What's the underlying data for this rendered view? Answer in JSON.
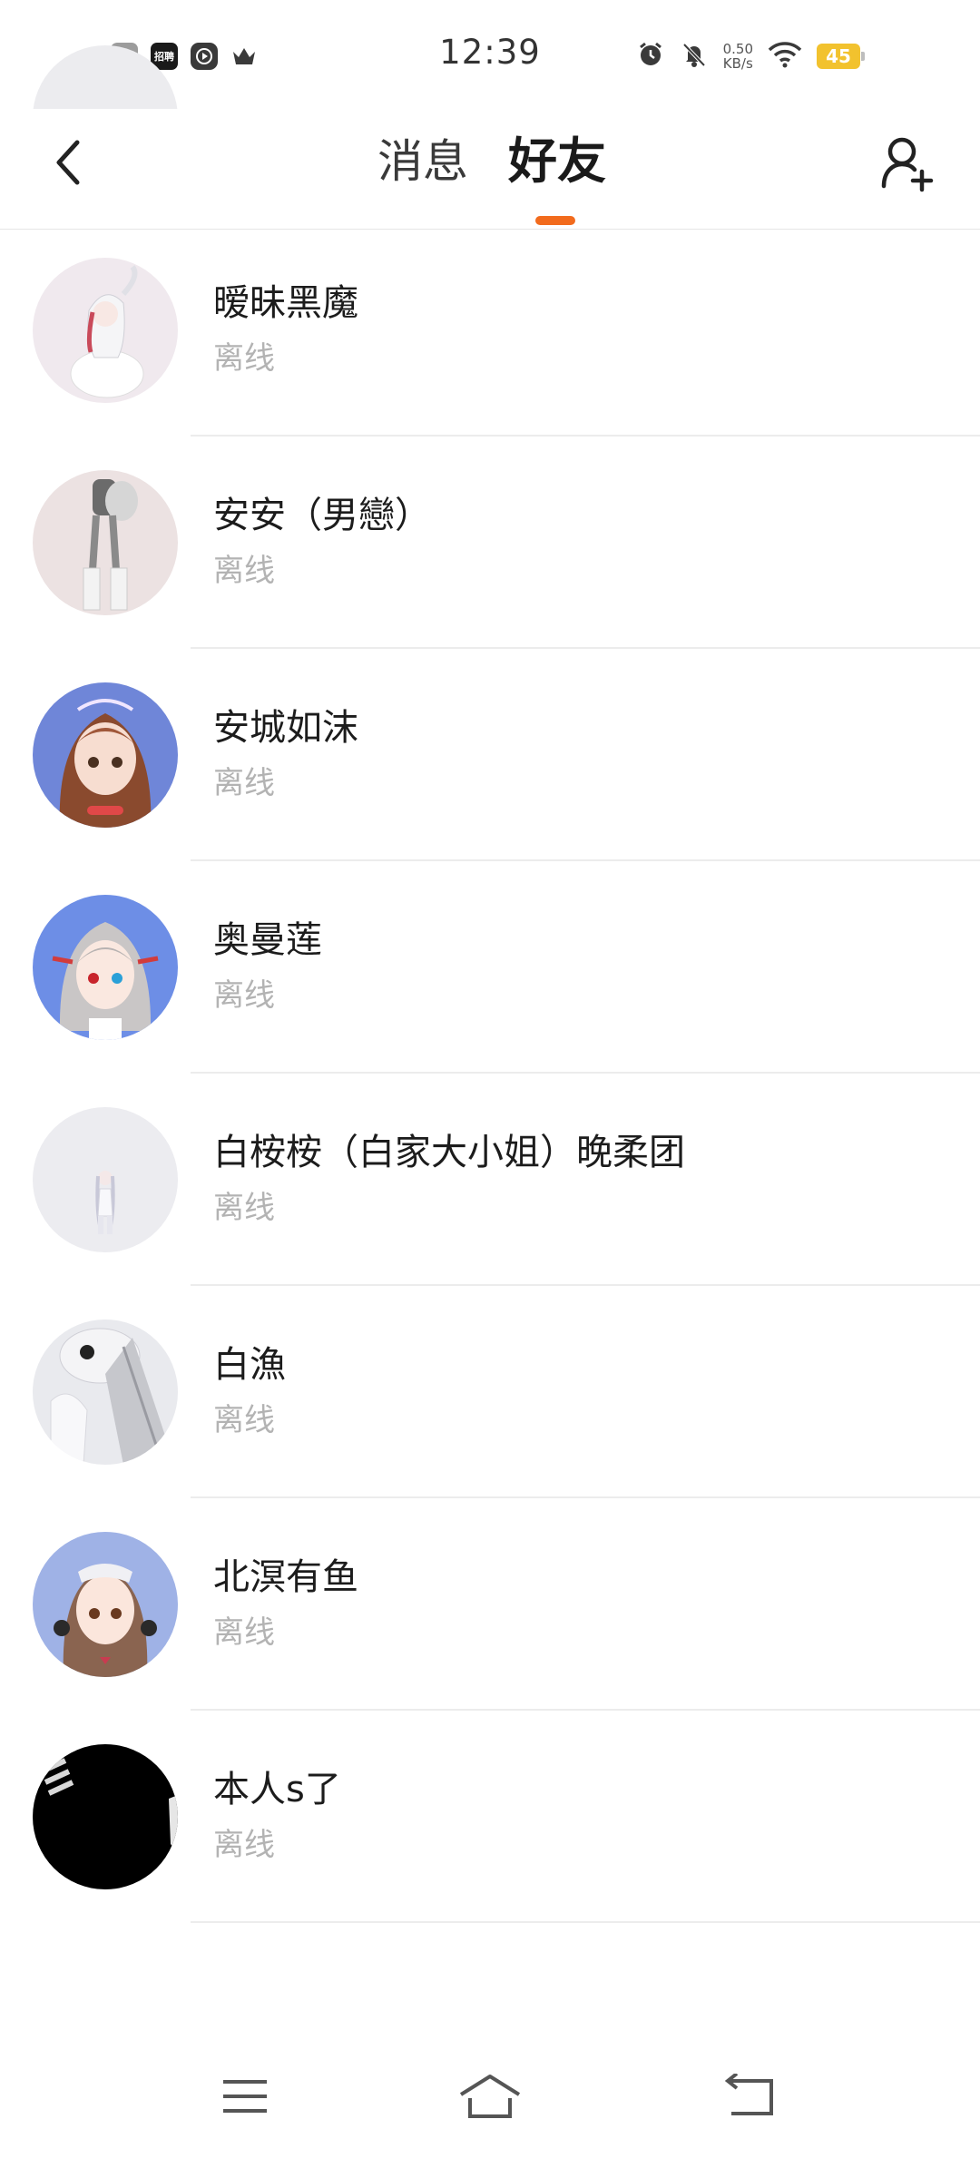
{
  "status_bar": {
    "time": "12:39",
    "net_speed_value": "0.50",
    "net_speed_unit": "KB/s",
    "battery_level": "45",
    "app_icon_label": "招聘"
  },
  "header": {
    "tab_messages": "消息",
    "tab_friends": "好友",
    "active_tab": "好友"
  },
  "friends": [
    {
      "name": "",
      "status": "离线"
    },
    {
      "name": "暧昧黑魔",
      "status": "离线"
    },
    {
      "name": "安安（男戀）",
      "status": "离线"
    },
    {
      "name": "安城如沫",
      "status": "离线"
    },
    {
      "name": "奥曼莲",
      "status": "离线"
    },
    {
      "name": "白桉桉（白家大小姐）晚柔团",
      "status": "离线"
    },
    {
      "name": "白漁",
      "status": "离线"
    },
    {
      "name": "北溟有鱼",
      "status": "离线"
    },
    {
      "name": "本人s了",
      "status": "离线"
    }
  ],
  "colors": {
    "accent": "#f26b1d",
    "status_text": "#b3b3b3",
    "divider": "#ececec",
    "battery": "#f2c22e"
  },
  "icons": {
    "back": "chevron-left-icon",
    "add_friend": "add-user-icon",
    "nav_menu": "menu-icon",
    "nav_home": "home-icon",
    "nav_back": "back-arrow-icon"
  }
}
